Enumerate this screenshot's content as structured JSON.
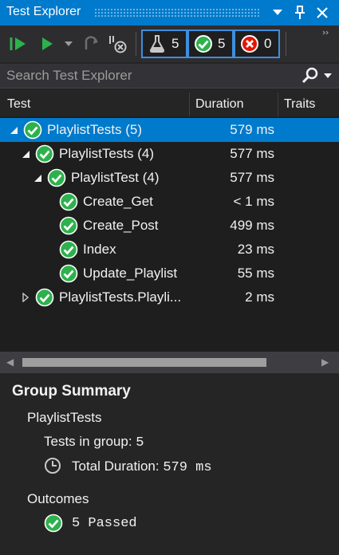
{
  "window": {
    "title": "Test Explorer",
    "menu_icon": "dropdown-arrow-icon",
    "pin_icon": "pin-icon",
    "close_icon": "close-icon"
  },
  "toolbar": {
    "run_all_icon": "run-all-icon",
    "run_icon": "run-icon",
    "refresh_icon": "refresh-icon",
    "cancel_icon": "cancel-icon",
    "filters": [
      {
        "icon": "flask-icon",
        "count": "5"
      },
      {
        "icon": "passed-icon",
        "count": "5"
      },
      {
        "icon": "failed-icon",
        "count": "0"
      }
    ],
    "overflow_icon": "overflow-icon"
  },
  "search": {
    "placeholder": "Search Test Explorer",
    "value": ""
  },
  "columns": {
    "test": "Test",
    "duration": "Duration",
    "traits": "Traits"
  },
  "rows": [
    {
      "name": "PlaylistTests",
      "count": "(5)",
      "duration": "579 ms",
      "level": 0,
      "expander": "expanded",
      "selected": true
    },
    {
      "name": "PlaylistTests",
      "count": "(4)",
      "duration": "577 ms",
      "level": 1,
      "expander": "expanded",
      "selected": false
    },
    {
      "name": "PlaylistTest",
      "count": "(4)",
      "duration": "577 ms",
      "level": 2,
      "expander": "expanded",
      "selected": false
    },
    {
      "name": "Create_Get",
      "count": "",
      "duration": "< 1 ms",
      "level": 3,
      "expander": "none",
      "selected": false
    },
    {
      "name": "Create_Post",
      "count": "",
      "duration": "499 ms",
      "level": 3,
      "expander": "none",
      "selected": false
    },
    {
      "name": "Index",
      "count": "",
      "duration": "23 ms",
      "level": 3,
      "expander": "none",
      "selected": false
    },
    {
      "name": "Update_Playlist",
      "count": "",
      "duration": "55 ms",
      "level": 3,
      "expander": "none",
      "selected": false
    },
    {
      "name": "PlaylistTests.Playli...",
      "count": "",
      "duration": "2 ms",
      "level": 1,
      "expander": "collapsed",
      "selected": false
    }
  ],
  "summary": {
    "heading": "Group Summary",
    "group_name": "PlaylistTests",
    "tests_in_group_label": "Tests in group:",
    "tests_in_group_value": "5",
    "total_duration_label": "Total Duration:",
    "total_duration_value": "579 ms",
    "outcomes_label": "Outcomes",
    "passed_text": "5 Passed"
  },
  "colors": {
    "accent": "#007acc",
    "pass": "#2db14c",
    "fail": "#e51400",
    "filter_border": "#3e8ede"
  }
}
